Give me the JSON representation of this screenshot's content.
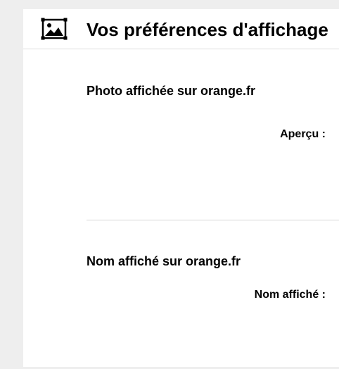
{
  "header": {
    "icon": "image-icon",
    "title": "Vos préférences d'affichage"
  },
  "photo_section": {
    "title": "Photo affichée sur orange.fr",
    "preview_label": "Aperçu :"
  },
  "name_section": {
    "title": "Nom affiché sur orange.fr",
    "name_label": "Nom affiché :"
  },
  "colors": {
    "background": "#eeeeee",
    "panel": "#ffffff",
    "divider": "#d6d6d6",
    "text": "#000000"
  }
}
